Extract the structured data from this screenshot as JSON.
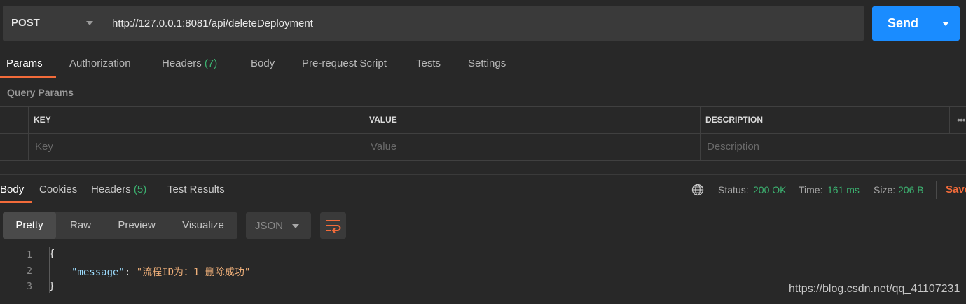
{
  "request": {
    "method": "POST",
    "url": "http://127.0.0.1:8081/api/deleteDeployment",
    "send_label": "Send",
    "tabs": [
      {
        "label": "Params",
        "active": true
      },
      {
        "label": "Authorization"
      },
      {
        "label": "Headers",
        "count": "(7)"
      },
      {
        "label": "Body"
      },
      {
        "label": "Pre-request Script"
      },
      {
        "label": "Tests"
      },
      {
        "label": "Settings"
      }
    ]
  },
  "query_params": {
    "title": "Query Params",
    "columns": [
      "KEY",
      "VALUE",
      "DESCRIPTION"
    ],
    "placeholders": [
      "Key",
      "Value",
      "Description"
    ],
    "more": "•••"
  },
  "response": {
    "tabs": [
      {
        "label": "Body",
        "active": true
      },
      {
        "label": "Cookies"
      },
      {
        "label": "Headers",
        "count": "(5)"
      },
      {
        "label": "Test Results"
      }
    ],
    "status_label": "Status:",
    "status_value": "200 OK",
    "time_label": "Time:",
    "time_value": "161 ms",
    "size_label": "Size:",
    "size_value": "206 B",
    "save_label": "Save",
    "views": [
      "Pretty",
      "Raw",
      "Preview",
      "Visualize"
    ],
    "active_view": "Pretty",
    "format": "JSON",
    "code": {
      "line_numbers": [
        "1",
        "2",
        "3"
      ],
      "open_brace": "{",
      "key": "\"message\"",
      "colon": ": ",
      "value": "\"流程ID为：1 删除成功\"",
      "close_brace": "}"
    }
  },
  "watermark": "https://blog.csdn.net/qq_41107231",
  "colors": {
    "accent": "#f26b3a",
    "send": "#1a8cff",
    "success": "#3cb371"
  }
}
